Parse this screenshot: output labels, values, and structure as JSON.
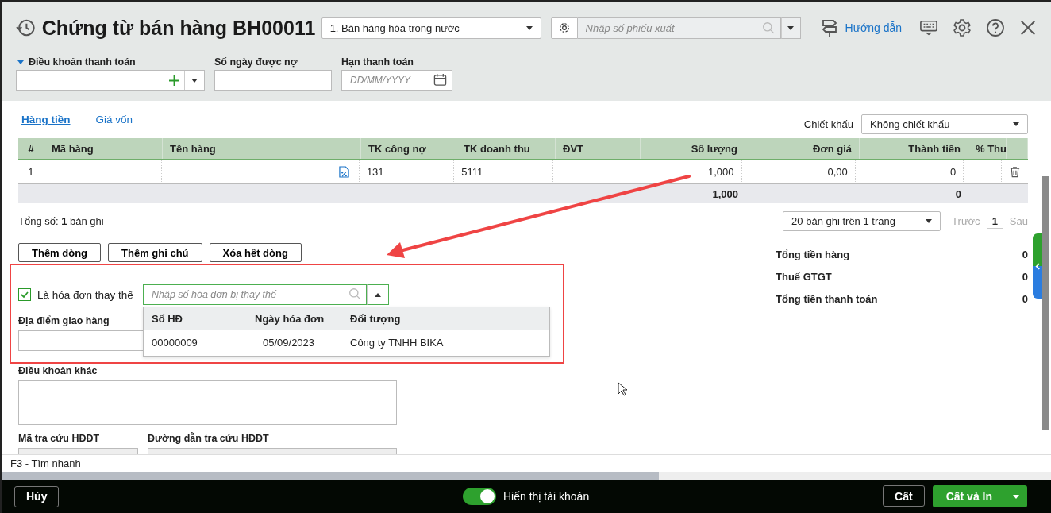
{
  "header": {
    "title": "Chứng từ bán hàng BH00011",
    "type_select": "1. Bán hàng hóa trong nước",
    "voucher_search": {
      "placeholder": "Nhập số phiếu xuất"
    },
    "guide_link": "Hướng dẫn"
  },
  "payment_fields": [
    {
      "label": "Điều khoản thanh toán",
      "kind": "combo"
    },
    {
      "label": "Số ngày được nợ",
      "kind": "text"
    },
    {
      "label": "Hạn thanh toán",
      "kind": "date",
      "placeholder": "DD/MM/YYYY"
    }
  ],
  "tabs": [
    {
      "label": "Hàng tiền",
      "selected": true
    },
    {
      "label": "Giá vốn",
      "selected": false
    }
  ],
  "discount": {
    "label": "Chiết khấu",
    "value": "Không chiết khấu"
  },
  "table": {
    "columns": [
      {
        "label": "#",
        "kind": "index"
      },
      {
        "label": "Mã hàng",
        "kind": "text"
      },
      {
        "label": "Tên hàng",
        "kind": "name"
      },
      {
        "label": "TK công nợ",
        "kind": "text"
      },
      {
        "label": "TK doanh thu",
        "kind": "text"
      },
      {
        "label": "ĐVT",
        "kind": "text"
      },
      {
        "label": "Số lượng",
        "kind": "number",
        "total": "1,000"
      },
      {
        "label": "Đơn giá",
        "kind": "number"
      },
      {
        "label": "Thành tiền",
        "kind": "number",
        "total": "0"
      },
      {
        "label": "% Thu",
        "kind": "text"
      }
    ],
    "rows": [
      {
        "cells": [
          "1",
          null,
          null,
          "131",
          "5111",
          null,
          "1,000",
          "0,00",
          "0",
          null
        ]
      }
    ]
  },
  "pagination": {
    "total": "Tổng số: **1** bản ghi",
    "page_size": "20 bản ghi trên 1 trang",
    "prev": {
      "label": "Trước",
      "disabled": true
    },
    "page": "1",
    "next": {
      "label": "Sau",
      "disabled": true
    }
  },
  "buttons": [
    "Thêm dòng",
    "Thêm ghi chú",
    "Xóa hết dòng"
  ],
  "replacement": {
    "label": "Là hóa đơn thay thế",
    "checked": true,
    "search_placeholder": "Nhập số hóa đơn bị thay thế",
    "dropdown": {
      "columns": [
        "Số HĐ",
        "Ngày hóa đơn",
        "Đối tượng"
      ],
      "rows": [
        [
          "00000009",
          "05/09/2023",
          "Công ty TNHH BIKA"
        ]
      ]
    }
  },
  "delivery_place": {
    "label": "Địa điểm giao hàng"
  },
  "other_terms": {
    "label": "Điều khoản khác"
  },
  "lookup_fields": [
    {
      "label": "Mã tra cứu HĐĐT"
    },
    {
      "label": "Đường dẫn tra cứu HĐĐT"
    }
  ],
  "summary": [
    {
      "label": "Tổng tiền hàng",
      "value": "0"
    },
    {
      "label": "Thuế GTGT",
      "value": "0"
    },
    {
      "label": "Tổng tiền thanh toán",
      "value": "0"
    }
  ],
  "status_bar": "F3 - Tìm nhanh",
  "footer": {
    "cancel": "Hủy",
    "toggle": {
      "label": "Hiển thị tài khoản",
      "on": true
    },
    "save": "Cất",
    "save_print": "Cất và In"
  }
}
